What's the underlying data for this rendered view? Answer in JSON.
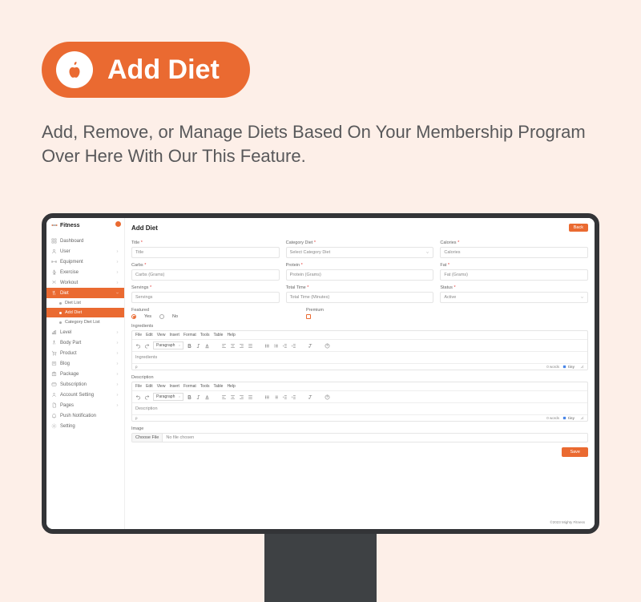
{
  "hero": {
    "pill_title": "Add Diet",
    "tagline": "Add, Remove, or Manage Diets Based On Your Membership Program Over Here With Our This Feature."
  },
  "brand": {
    "name": "Fitness"
  },
  "nav": {
    "dashboard": "Dashboard",
    "user": "User",
    "equipment": "Equipment",
    "exercise": "Exercise",
    "workout": "Workout",
    "diet": "Diet",
    "diet_list": "Diet List",
    "add_diet": "Add Diet",
    "category_diet_list": "Category Diet List",
    "level": "Level",
    "body_part": "Body Part",
    "product": "Product",
    "blog": "Blog",
    "package": "Package",
    "subscription": "Subscription",
    "account_setting": "Account Setting",
    "pages": "Pages",
    "push_notification": "Push Notification",
    "setting": "Setting"
  },
  "page": {
    "title": "Add Diet",
    "back": "Back",
    "save": "Save"
  },
  "fields": {
    "title": {
      "label": "Title",
      "placeholder": "Title"
    },
    "category": {
      "label": "Category Diet",
      "placeholder": "Select Category Diet"
    },
    "calories": {
      "label": "Calories",
      "placeholder": "Calories"
    },
    "carbs": {
      "label": "Carbs",
      "placeholder": "Carbs (Grams)"
    },
    "protein": {
      "label": "Protein",
      "placeholder": "Protein (Grams)"
    },
    "fat": {
      "label": "Fat",
      "placeholder": "Fat (Grams)"
    },
    "servings": {
      "label": "Servings",
      "placeholder": "Servings"
    },
    "total_time": {
      "label": "Total Time",
      "placeholder": "Total Time (Minutes)"
    },
    "status": {
      "label": "Status",
      "value": "Active"
    },
    "featured": {
      "label": "Featured",
      "yes": "Yes",
      "no": "No"
    },
    "premium": {
      "label": "Premium"
    },
    "ingredients_label": "Ingredients",
    "description_label": "Description",
    "image_label": "Image",
    "choose_file": "Choose File",
    "no_file": "No file chosen"
  },
  "editor": {
    "menu": [
      "File",
      "Edit",
      "View",
      "Insert",
      "Format",
      "Tools",
      "Table",
      "Help"
    ],
    "paragraph": "Paragraph",
    "placeholder_ing": "Ingredients",
    "placeholder_desc": "Description",
    "path": "p",
    "word_count": "0 words",
    "tiny": "tiny"
  },
  "footer": {
    "copyright": "©2023 Mighty Fitness"
  }
}
